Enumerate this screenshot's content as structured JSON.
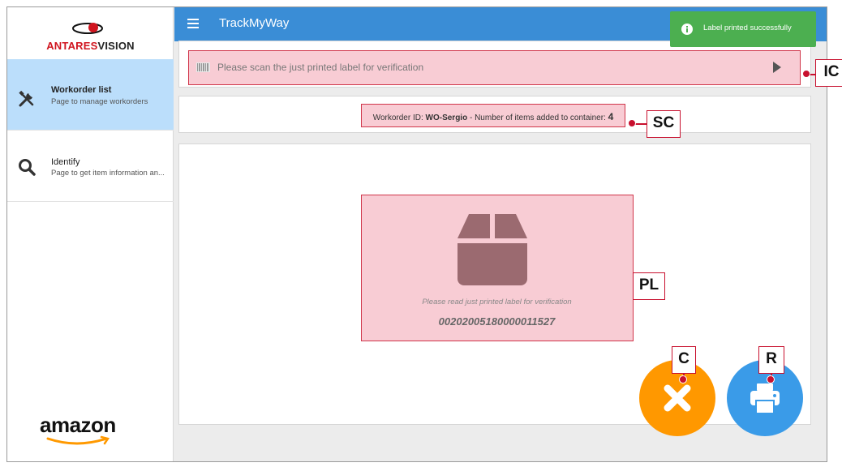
{
  "brand": {
    "logo_text_red": "ANTARES",
    "logo_text_black": "VISION",
    "partner_logo": "amazon",
    "accent_color": "#3a8dd6",
    "highlight_color": "#f8ccd4"
  },
  "topbar": {
    "title": "TrackMyWay",
    "menu_icon": "hamburger-menu-icon"
  },
  "sidebar": {
    "items": [
      {
        "title": "Workorder list",
        "subtitle": "Page to manage workorders",
        "icon": "tools-icon",
        "active": true
      },
      {
        "title": "Identify",
        "subtitle": "Page to get item information an...",
        "icon": "search-icon",
        "active": false
      }
    ]
  },
  "scan": {
    "placeholder": "Please scan the just printed label for verification",
    "icon": "barcode-icon",
    "submit_icon": "play-icon"
  },
  "status": {
    "prefix": "Workorder ID: ",
    "workorder_id": "WO-Sergio",
    "middle": " - Number of items added to container: ",
    "count": "4"
  },
  "label_panel": {
    "caption": "Please read just printed label for verification",
    "code": "00202005180000011527",
    "icon": "box-icon"
  },
  "actions": {
    "cancel_icon": "close-icon",
    "print_icon": "printer-icon",
    "cancel_color": "#ff9800",
    "print_color": "#3a9be8"
  },
  "toast": {
    "message": "Label printed successfully",
    "icon": "info-icon",
    "color": "#4caf50"
  },
  "callouts": {
    "ic": "IC",
    "sc": "SC",
    "pl": "PL",
    "c": "C",
    "r": "R"
  }
}
